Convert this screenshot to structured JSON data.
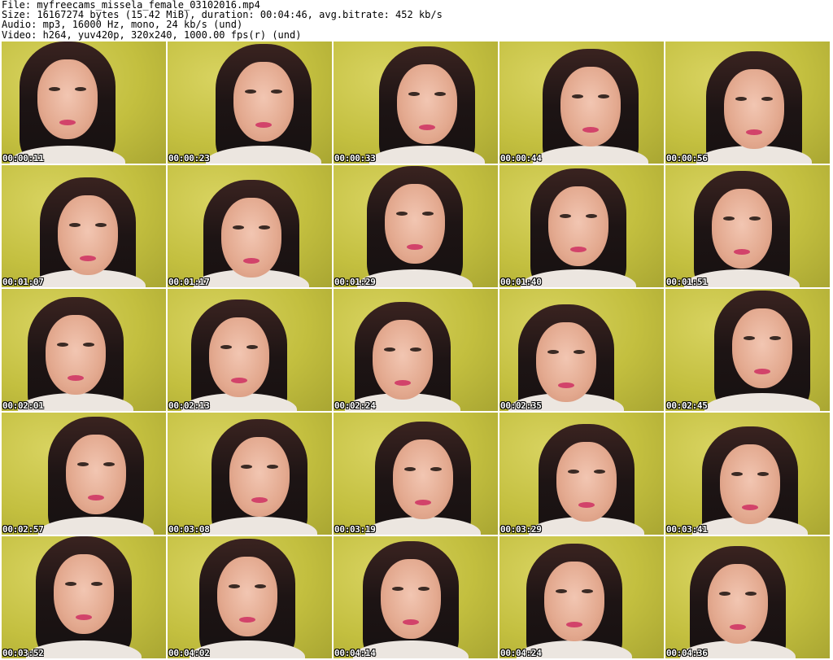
{
  "header": {
    "file_line": "File: myfreecams_missela_female_03102016.mp4",
    "size_line": "Size: 16167274 bytes (15.42 MiB), duration: 00:04:46, avg.bitrate: 452 kb/s",
    "audio_line": "Audio: mp3, 16000 Hz, mono, 24 kb/s (und)",
    "video_line": "Video: h264, yuv420p, 320x240, 1000.00 fps(r) (und)"
  },
  "thumbnails": [
    {
      "time": "00:00:11"
    },
    {
      "time": "00:00:23"
    },
    {
      "time": "00:00:33"
    },
    {
      "time": "00:00:44"
    },
    {
      "time": "00:00:56"
    },
    {
      "time": "00:01:07"
    },
    {
      "time": "00:01:17"
    },
    {
      "time": "00:01:29"
    },
    {
      "time": "00:01:40"
    },
    {
      "time": "00:01:51"
    },
    {
      "time": "00:02:01"
    },
    {
      "time": "00:02:13"
    },
    {
      "time": "00:02:24"
    },
    {
      "time": "00:02:35"
    },
    {
      "time": "00:02:45"
    },
    {
      "time": "00:02:57"
    },
    {
      "time": "00:03:08"
    },
    {
      "time": "00:03:19"
    },
    {
      "time": "00:03:29"
    },
    {
      "time": "00:03:41"
    },
    {
      "time": "00:03:52"
    },
    {
      "time": "00:04:02"
    },
    {
      "time": "00:04:14"
    },
    {
      "time": "00:04:24"
    },
    {
      "time": "00:04:36"
    }
  ],
  "colors": {
    "background": "#ffffff",
    "wall": "#c9c44a",
    "timestamp_text": "#ffffff"
  }
}
